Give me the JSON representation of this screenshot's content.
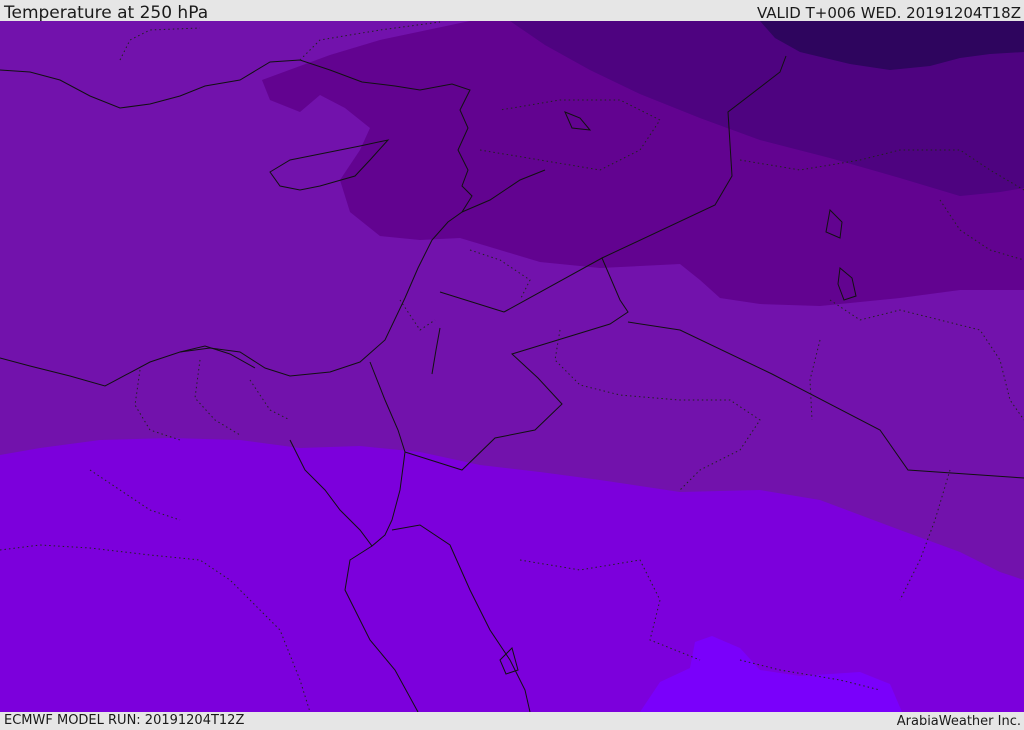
{
  "header": {
    "title": "Temperature at 250 hPa",
    "valid": "VALID T+006 WED. 20191204T18Z"
  },
  "footer": {
    "model_run": "ECMWF MODEL RUN: 20191204T12Z",
    "brand": "ArabiaWeather Inc."
  },
  "colors": {
    "band_darkest": "#2e055e",
    "band_dark": "#4e0380",
    "band_mid_dark": "#620390",
    "band_mid": "#7212ac",
    "band_light": "#7c00dc",
    "band_lightest": "#7a00fb",
    "border_line": "#111111"
  }
}
